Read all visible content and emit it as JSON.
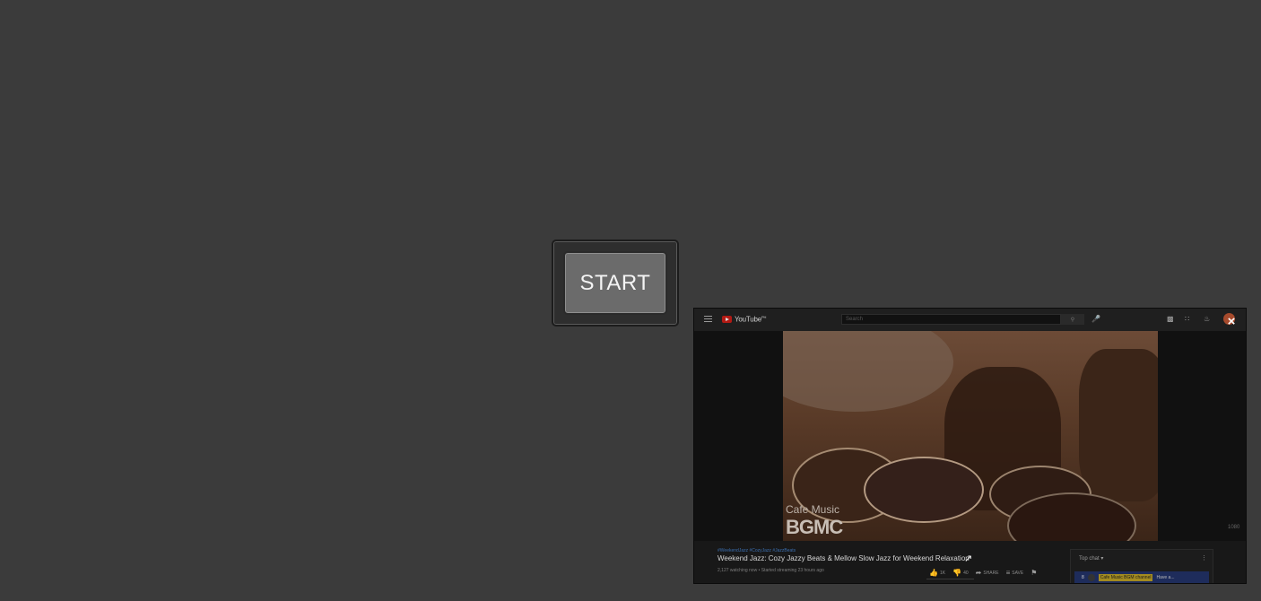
{
  "start_button": {
    "label": "START"
  },
  "youtube_window": {
    "brand": "YouTube",
    "brand_suffix": "PH",
    "search_placeholder": "Search",
    "close_label": "×",
    "hd_badge": "1080",
    "video": {
      "caption": "Cafe Music",
      "logo": "BGMC"
    },
    "info": {
      "tags": "#WeekendJazz #CozyJazz #JazzBeats",
      "title": "Weekend Jazz: Cozy Jazzy Beats & Mellow Slow Jazz for Weekend Relaxation",
      "meta": "2,127 watching now • Started streaming 23 hours ago",
      "actions": {
        "likes": "1K",
        "dislikes": "40",
        "share": "SHARE",
        "save": "SAVE"
      }
    },
    "chat": {
      "header": "Top chat",
      "row_num": "8",
      "badge": "Cafe Music BGM channel",
      "message": "Have a..."
    }
  }
}
